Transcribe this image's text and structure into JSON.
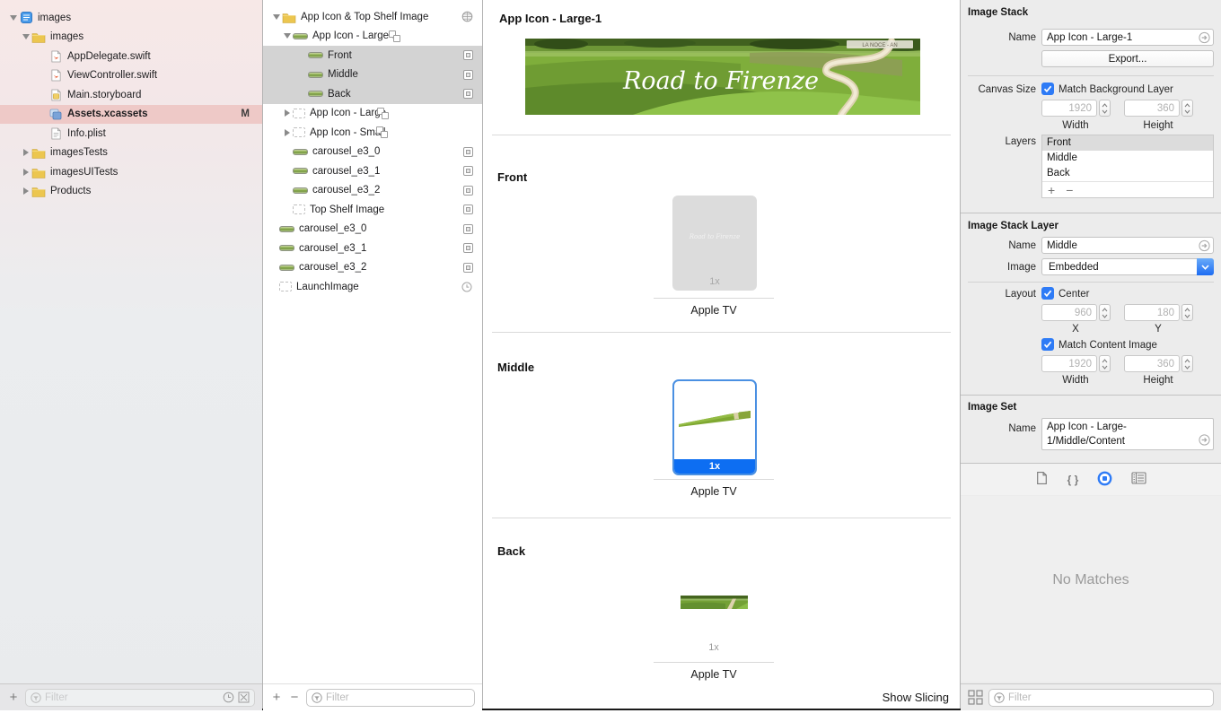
{
  "navigator": {
    "items": [
      {
        "label": "images"
      },
      {
        "label": "images"
      },
      {
        "label": "AppDelegate.swift"
      },
      {
        "label": "ViewController.swift"
      },
      {
        "label": "Main.storyboard"
      },
      {
        "label": "Assets.xcassets",
        "badge": "M"
      },
      {
        "label": "Info.plist"
      },
      {
        "label": "imagesTests"
      },
      {
        "label": "imagesUITests"
      },
      {
        "label": "Products"
      }
    ],
    "filter_placeholder": "Filter"
  },
  "outline": {
    "items": [
      {
        "label": "App Icon & Top Shelf Image"
      },
      {
        "label": "App Icon - Large-1"
      },
      {
        "label": "Front"
      },
      {
        "label": "Middle"
      },
      {
        "label": "Back"
      },
      {
        "label": "App Icon - Large"
      },
      {
        "label": "App Icon - Small"
      },
      {
        "label": "carousel_e3_0"
      },
      {
        "label": "carousel_e3_1"
      },
      {
        "label": "carousel_e3_2"
      },
      {
        "label": "Top Shelf Image"
      },
      {
        "label": "carousel_e3_0"
      },
      {
        "label": "carousel_e3_1"
      },
      {
        "label": "carousel_e3_2"
      },
      {
        "label": "LaunchImage"
      }
    ],
    "filter_placeholder": "Filter"
  },
  "editor": {
    "title": "App Icon - Large-1",
    "banner_text": "Road to Firenze",
    "placeholder_text": "Road to Firenze",
    "sections": [
      {
        "label": "Front",
        "scale": "1x",
        "device": "Apple TV"
      },
      {
        "label": "Middle",
        "scale": "1x",
        "device": "Apple TV"
      },
      {
        "label": "Back",
        "scale": "1x",
        "device": "Apple TV"
      }
    ],
    "show_slicing": "Show Slicing"
  },
  "inspector": {
    "image_stack": {
      "header": "Image Stack",
      "name_label": "Name",
      "name_value": "App Icon - Large-1",
      "export_label": "Export...",
      "canvas_size_label": "Canvas Size",
      "match_background_label": "Match Background Layer",
      "width_value": "1920",
      "height_value": "360",
      "width_label": "Width",
      "height_label": "Height",
      "layers_label": "Layers",
      "layers": [
        "Front",
        "Middle",
        "Back"
      ]
    },
    "image_stack_layer": {
      "header": "Image Stack Layer",
      "name_label": "Name",
      "name_value": "Middle",
      "image_label": "Image",
      "image_value": "Embedded",
      "layout_label": "Layout",
      "center_label": "Center",
      "x_value": "960",
      "y_value": "180",
      "x_label": "X",
      "y_label": "Y",
      "match_content_label": "Match Content Image",
      "width_value": "1920",
      "height_value": "360",
      "width_label": "Width",
      "height_label": "Height"
    },
    "image_set": {
      "header": "Image Set",
      "name_label": "Name",
      "name_value": "App Icon - Large-1/Middle/Content"
    },
    "library": {
      "empty_text": "No Matches",
      "filter_placeholder": "Filter"
    }
  },
  "icons": {
    "plus": "+",
    "minus": "−",
    "braces": "{ }"
  },
  "colors": {
    "accent_blue": "#0d6ef2",
    "selection_pink": "#eec9c7",
    "selection_gray": "#d3d3d3"
  }
}
